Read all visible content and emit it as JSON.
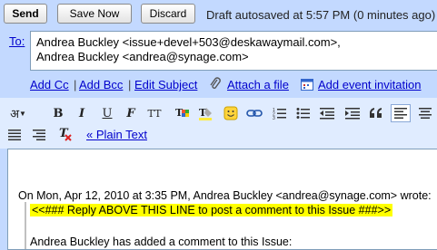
{
  "toolbar": {
    "send_label": "Send",
    "save_label": "Save Now",
    "discard_label": "Discard",
    "status": "Draft autosaved at 5:57 PM (0 minutes ago)"
  },
  "to": {
    "label": "To:",
    "recipient_1": "Andrea Buckley <issue+devel+503@deskawaymail.com>,",
    "recipient_2": "Andrea Buckley <andrea@synage.com>"
  },
  "actions": {
    "add_cc": "Add Cc",
    "add_bcc": "Add Bcc",
    "edit_subject": "Edit Subject",
    "attach_file": "Attach a file",
    "add_event": "Add event invitation",
    "separator": "|"
  },
  "format": {
    "lang_glyph": "अ",
    "bold": "B",
    "italic": "I",
    "underline": "U",
    "font": "F",
    "size": "TT",
    "plain_text": "« Plain Text"
  },
  "body": {
    "quote_header": "On Mon, Apr 12, 2010 at 3:35 PM, Andrea Buckley <andrea@synage.com> wrote:",
    "reply_line": "<<### Reply ABOVE THIS LINE to post a comment to this Issue ###>>",
    "comment_line": "Andrea Buckley has added a comment to this Issue:"
  },
  "colors": {
    "background": "#c3d9ff",
    "link": "#0000cc",
    "highlight": "#ffff00",
    "format_bar": "#e0ecff"
  }
}
